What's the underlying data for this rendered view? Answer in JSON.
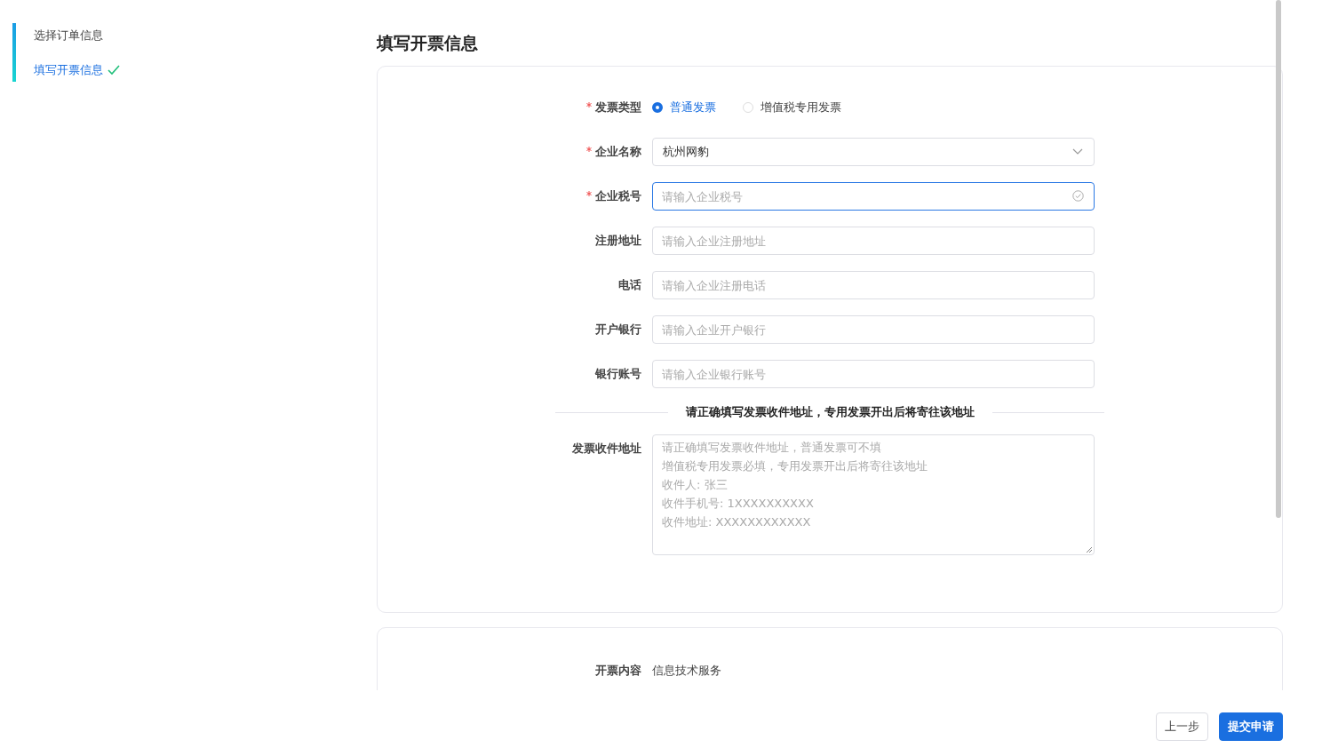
{
  "steps": [
    {
      "label": "选择订单信息",
      "selected": false,
      "completed": false
    },
    {
      "label": "填写开票信息",
      "selected": true,
      "completed": true
    }
  ],
  "title": "填写开票信息",
  "form": {
    "fields": [
      {
        "kind": "radio",
        "label": "发票类型",
        "required": true,
        "options": [
          {
            "label": "普通发票",
            "selected": true
          },
          {
            "label": "增值税专用发票",
            "selected": false
          }
        ]
      },
      {
        "kind": "select",
        "label": "企业名称",
        "required": true,
        "value": "杭州网豹"
      },
      {
        "kind": "input",
        "label": "企业税号",
        "required": true,
        "placeholder": "请输入企业税号",
        "focused": true
      },
      {
        "kind": "input",
        "label": "注册地址",
        "required": false,
        "placeholder": "请输入企业注册地址",
        "focused": false
      },
      {
        "kind": "input",
        "label": "电话",
        "required": false,
        "placeholder": "请输入企业注册电话",
        "focused": false
      },
      {
        "kind": "input",
        "label": "开户银行",
        "required": false,
        "placeholder": "请输入企业开户银行",
        "focused": false
      },
      {
        "kind": "input",
        "label": "银行账号",
        "required": false,
        "placeholder": "请输入企业银行账号",
        "focused": false
      },
      {
        "kind": "divider",
        "label": "请正确填写发票收件地址，专用发票开出后将寄往该地址"
      },
      {
        "kind": "textarea",
        "label": "发票收件地址",
        "required": false,
        "placeholder_lines": [
          "请正确填写发票收件地址，普通发票可不填",
          "增值税专用发票必填，专用发票开出后将寄往该地址",
          "收件人: 张三",
          "收件手机号: 1XXXXXXXXXX",
          "收件地址: XXXXXXXXXXXX"
        ]
      }
    ]
  },
  "content": {
    "label": "开票内容",
    "value": "信息技术服务"
  },
  "buttons": [
    {
      "label": "上一步",
      "kind": "default"
    },
    {
      "label": "提交申请",
      "kind": "primary"
    }
  ]
}
